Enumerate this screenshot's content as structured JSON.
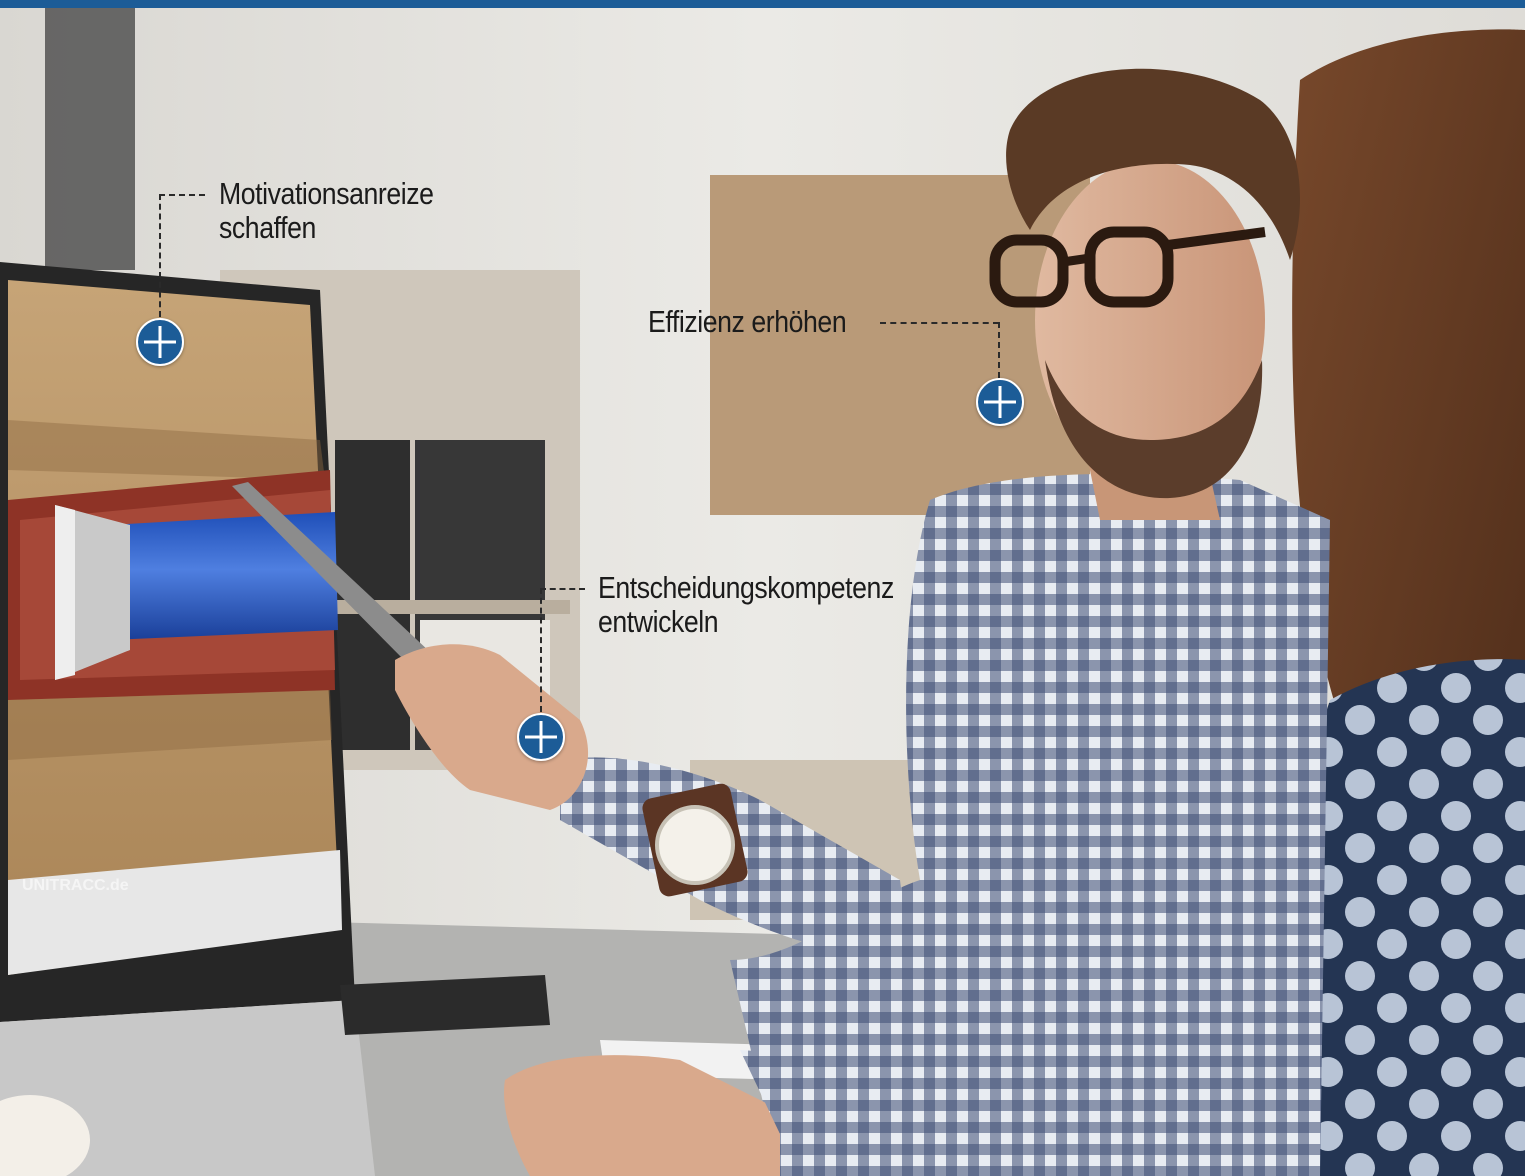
{
  "brand_color": "#1c5c97",
  "hotspot_icon": "plus-circle-icon",
  "callouts": [
    {
      "id": "motivation",
      "lines": [
        "Motivationsanreize",
        "schaffen"
      ]
    },
    {
      "id": "efficiency",
      "lines": [
        "Effizienz erhöhen"
      ]
    },
    {
      "id": "decision",
      "lines": [
        "Entscheidungskompetenz",
        "entwickeln"
      ]
    }
  ],
  "screen": {
    "logo_text": "UNITRACC.de"
  }
}
